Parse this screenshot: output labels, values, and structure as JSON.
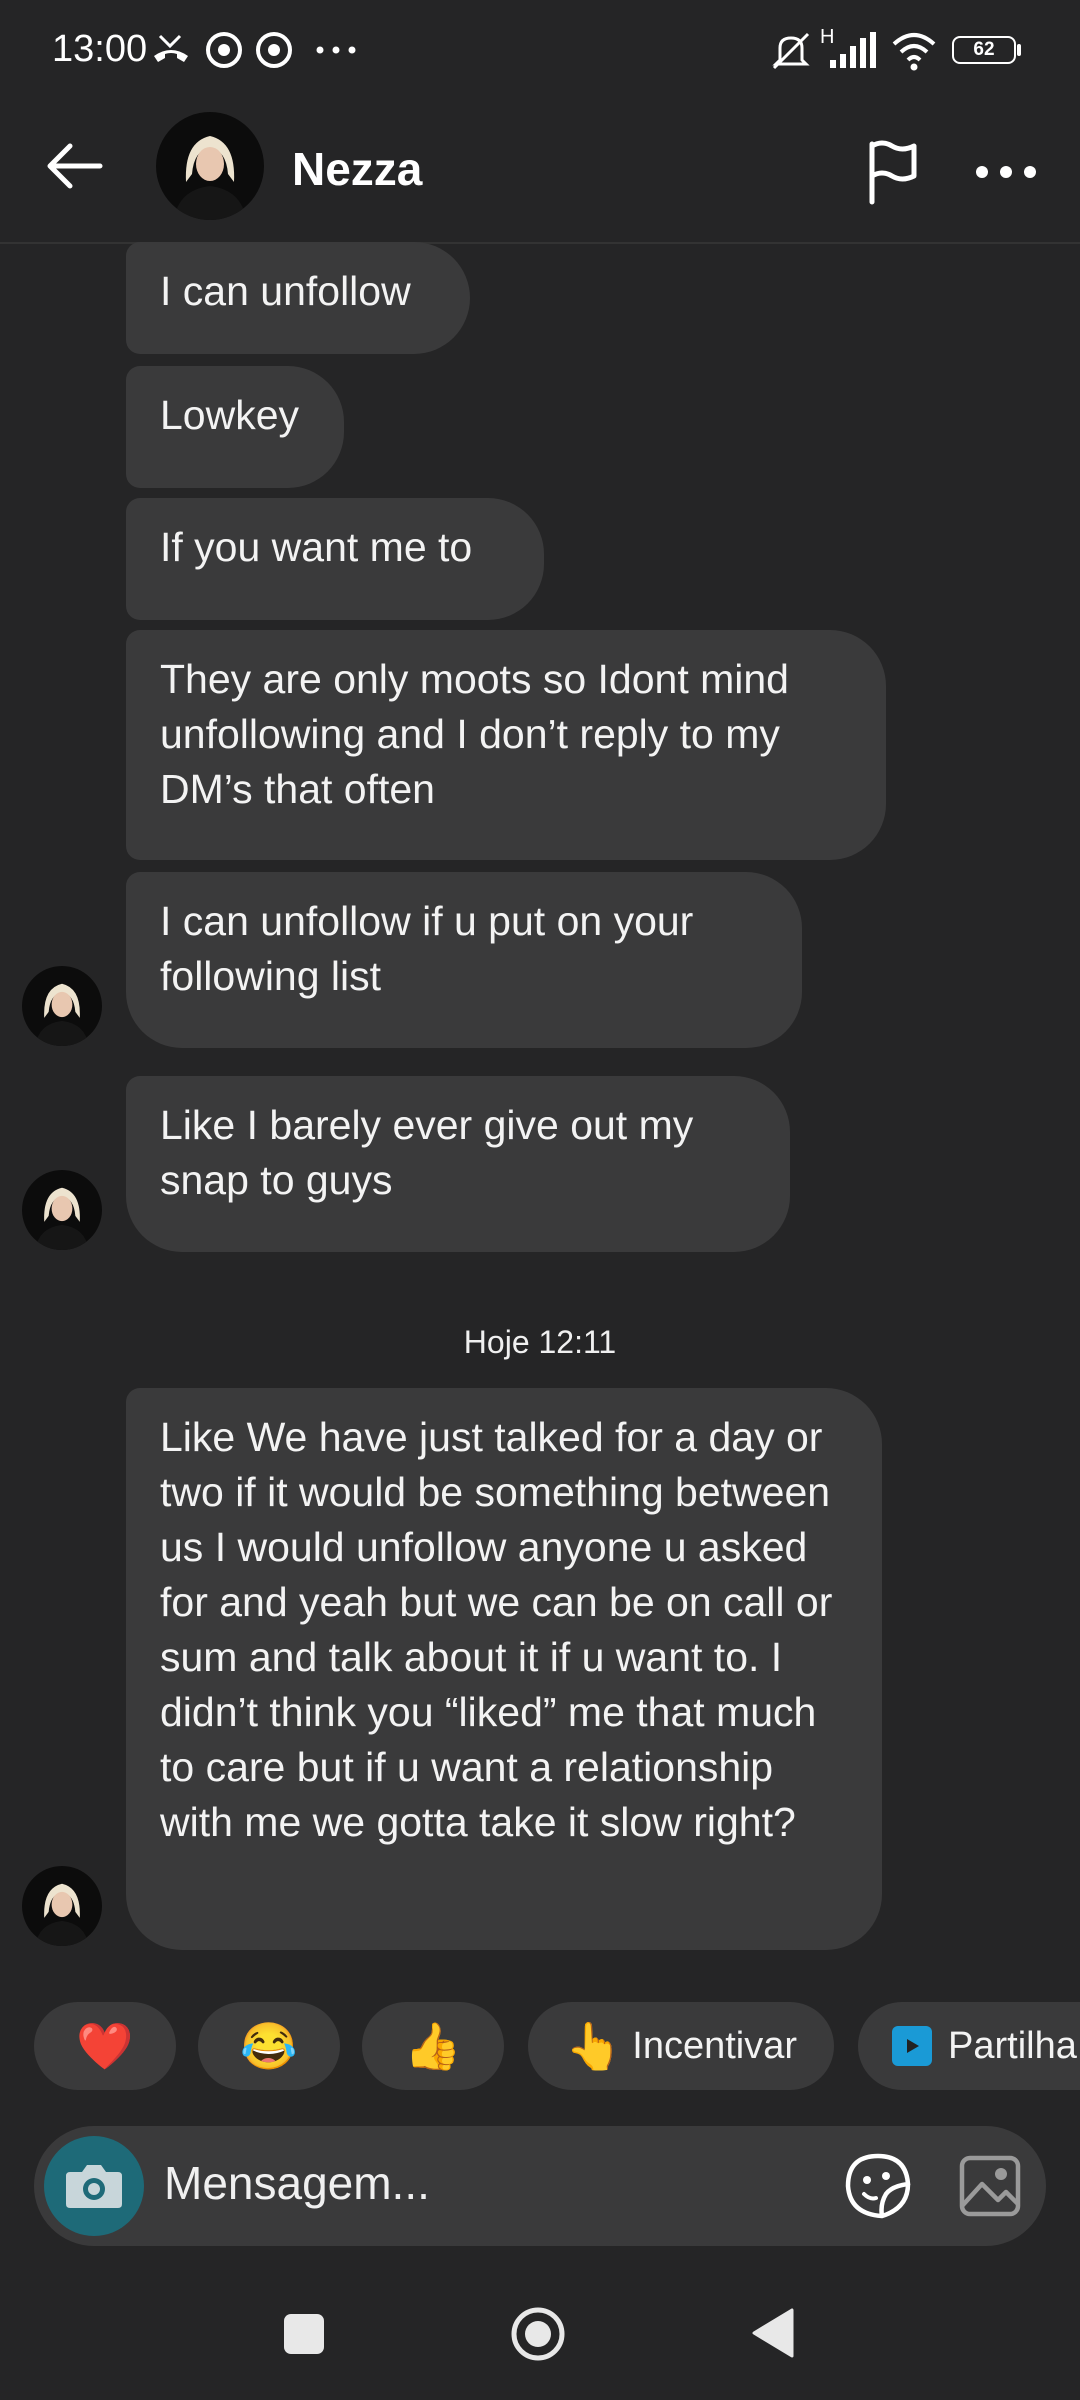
{
  "status_bar": {
    "time": "13:00",
    "battery": "62",
    "network": "H",
    "icons": [
      "missed-call-icon",
      "chrome-icon",
      "chrome-icon",
      "more-dots-icon",
      "mute-icon",
      "signal-icon",
      "wifi-icon",
      "battery-icon"
    ]
  },
  "header": {
    "contact_name": "Nezza",
    "icons": [
      "back-arrow-icon",
      "flag-icon",
      "more-horizontal-icon"
    ]
  },
  "messages": [
    {
      "text": "I can unfollow"
    },
    {
      "text": "Lowkey"
    },
    {
      "text": "If you want me to"
    },
    {
      "text": "They are only moots so Idont mind unfollowing and I don’t reply to my DM’s that often"
    },
    {
      "text": "I can unfollow if u put on your following list"
    },
    {
      "text": "Like I barely ever give out my snap to guys"
    },
    {
      "text": "Like We have just talked for a day or two if it would be something between us I would unfollow anyone u asked for and yeah but we can be on call or sum and talk about it if u want to. I didn’t think you “liked” me that much to care but if u want a relationship with me we gotta take it slow right?"
    }
  ],
  "timestamp": "Hoje 12:11",
  "reactions": [
    {
      "emoji": "❤️",
      "label": ""
    },
    {
      "emoji": "😂",
      "label": ""
    },
    {
      "emoji": "👍",
      "label": ""
    },
    {
      "emoji": "👆",
      "label": "Incentivar"
    },
    {
      "emoji": "▶",
      "label": "Partilha"
    }
  ],
  "composer": {
    "placeholder": "Mensagem..."
  },
  "colors": {
    "background": "#252526",
    "bubble": "#3a3a3b",
    "camera": "#1e6a78",
    "share_icon": "#1a9ad6"
  }
}
